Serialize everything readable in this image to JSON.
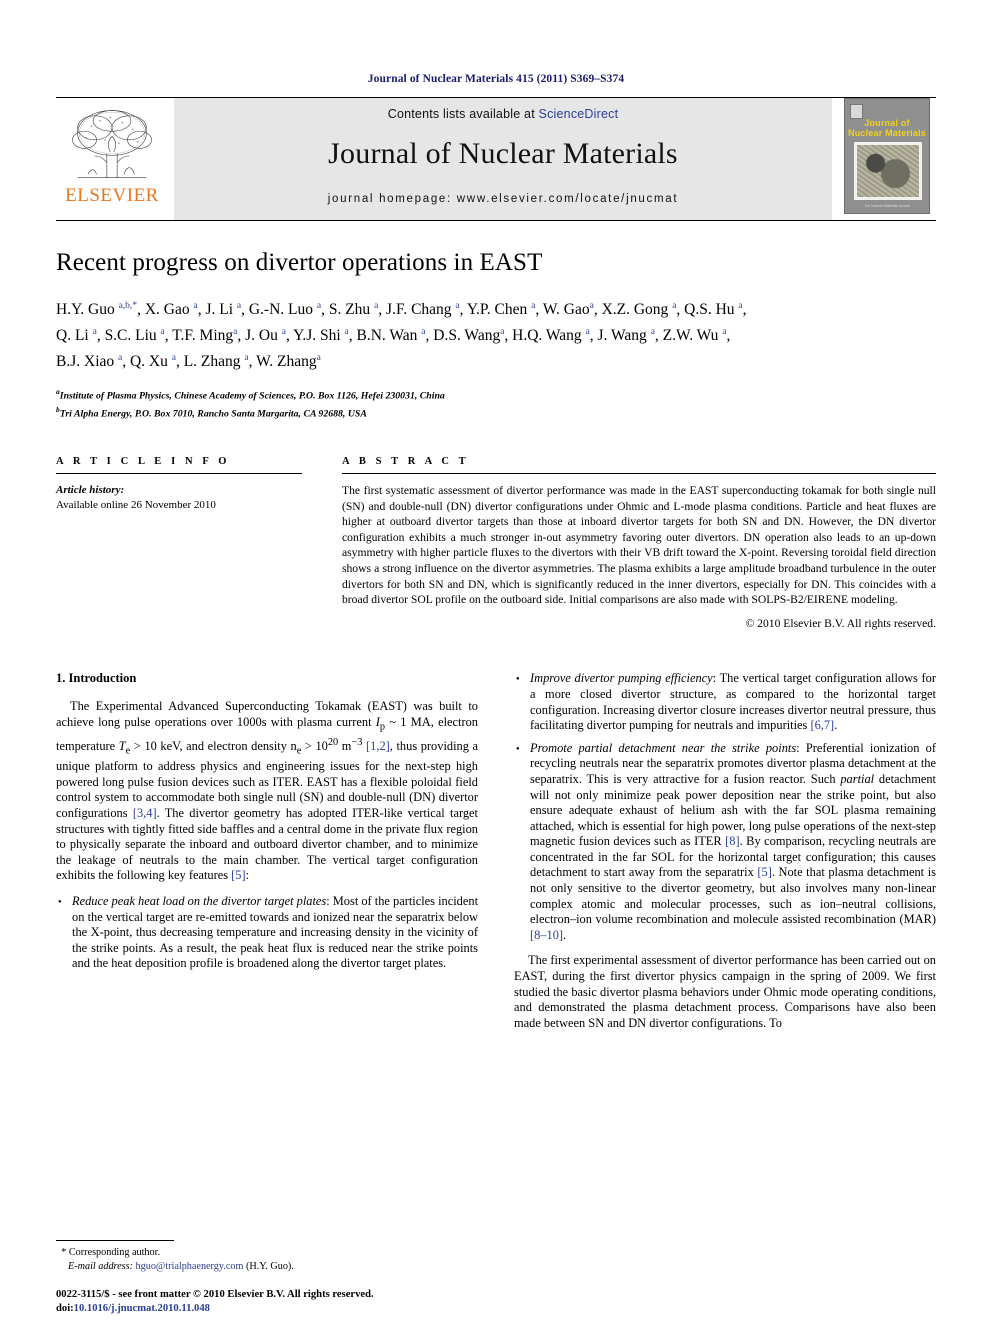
{
  "running_head": "Journal of Nuclear Materials 415 (2011) S369–S374",
  "masthead": {
    "contents_prefix": "Contents lists available at ",
    "sciencedirect": "ScienceDirect",
    "journal_title": "Journal of Nuclear Materials",
    "homepage": "journal homepage: www.elsevier.com/locate/jnucmat",
    "publisher_wordmark": "ELSEVIER",
    "cover_title_line1": "Journal of",
    "cover_title_line2": "Nuclear Materials",
    "cover_footer": "The Nuclear Materials Journal"
  },
  "article": {
    "title": "Recent progress on divertor operations in EAST",
    "authors_line1": "H.Y. Guo a,b,*, X. Gao a, J. Li a, G.-N. Luo a, S. Zhu a, J.F. Chang a, Y.P. Chen a, W. Gao a, X.Z. Gong a, Q.S. Hu a,",
    "authors_line2": "Q. Li a, S.C. Liu a, T.F. Ming a, J. Ou a, Y.J. Shi a, B.N. Wan a, D.S. Wang a, H.Q. Wang a, J. Wang a, Z.W. Wu a,",
    "authors_line3": "B.J. Xiao a, Q. Xu a, L. Zhang a, W. Zhang a",
    "affiliation_a": "Institute of Plasma Physics, Chinese Academy of Sciences, P.O. Box 1126, Hefei 230031, China",
    "affiliation_b": "Tri Alpha Energy, P.O. Box 7010, Rancho Santa Margarita, CA 92688, USA"
  },
  "article_info": {
    "heading": "A R T I C L E    I N F O",
    "history_label": "Article history:",
    "history_value": "Available online 26 November 2010"
  },
  "abstract": {
    "heading": "A B S T R A C T",
    "text": "The first systematic assessment of divertor performance was made in the EAST superconducting tokamak for both single null (SN) and double-null (DN) divertor configurations under Ohmic and L-mode plasma conditions. Particle and heat fluxes are higher at outboard divertor targets than those at inboard divertor targets for both SN and DN. However, the DN divertor configuration exhibits a much stronger in-out asymmetry favoring outer divertors. DN operation also leads to an up-down asymmetry with higher particle fluxes to the divertors with their VB drift toward the X-point. Reversing toroidal field direction shows a strong influence on the divertor asymmetries. The plasma exhibits a large amplitude broadband turbulence in the outer divertors for both SN and DN, which is significantly reduced in the inner divertors, especially for DN. This coincides with a broad divertor SOL profile on the outboard side. Initial comparisons are also made with SOLPS-B2/EIRENE modeling.",
    "copyright": "© 2010 Elsevier B.V. All rights reserved."
  },
  "section": {
    "heading": "1. Introduction",
    "para1_a": "The Experimental Advanced Superconducting Tokamak (EAST) was built to achieve long pulse operations over 1000s with plasma current ",
    "para1_ip": "I",
    "para1_ip_sub": "p",
    "para1_b": " ~ 1 MA, electron temperature ",
    "para1_te": "T",
    "para1_te_sub": "e",
    "para1_c": " > 10 keV, and electron density n",
    "para1_ne_sub": "e",
    "para1_d": " > 10",
    "para1_exp1": "20",
    "para1_e": " m",
    "para1_exp2": "−3",
    "para1_ref12": " [1,2]",
    "para1_f": ", thus providing a unique platform to address physics and engineering issues for the next-step high powered long pulse fusion devices such as ITER. EAST has a flexible poloidal field control system to accommodate both single null (SN) and double-null (DN) divertor configurations",
    "para1_ref34": " [3,4]",
    "para1_g": ". The divertor geometry has adopted ITER-like vertical target structures with tightly fitted side baffles and a central dome in the private flux region to physically separate the inboard and outboard divertor chamber, and to minimize the leakage of neutrals to the main chamber. The vertical target configuration exhibits the following key features",
    "para1_ref5": " [5]",
    "para1_h": ":",
    "bullet1_lead": "Reduce peak heat load on the divertor target plates",
    "bullet1_body": ": Most of the particles incident on the vertical target are re-emitted towards and ionized near the separatrix below the X-point, thus decreasing temperature and increasing density in the vicinity of the strike points. As a result, the peak heat flux is reduced near the strike points and the heat deposition profile is broadened along the divertor target plates.",
    "bullet2_lead": "Improve divertor pumping efficiency",
    "bullet2_body": ": The vertical target configuration allows for a more closed divertor structure, as compared to the horizontal target configuration. Increasing divertor closure increases divertor neutral pressure, thus facilitating divertor pumping for neutrals and impurities",
    "bullet2_ref": " [6,7]",
    "bullet2_end": ".",
    "bullet3_lead": "Promote partial detachment near the strike points",
    "bullet3_a": ": Preferential ionization of recycling neutrals near the separatrix promotes divertor plasma detachment at the separatrix. This is very attractive for a fusion reactor. Such ",
    "bullet3_ital": "partial",
    "bullet3_b": " detachment will not only minimize peak power deposition near the strike point, but also ensure adequate exhaust of helium ash with the far SOL plasma remaining attached, which is essential for high power, long pulse operations of the next-step magnetic fusion devices such as ITER",
    "bullet3_ref8": " [8]",
    "bullet3_c": ". By comparison, recycling neutrals are concentrated in the far SOL for the horizontal target configuration; this causes detachment to start away from the separatrix",
    "bullet3_ref5": " [5]",
    "bullet3_d": ". Note that plasma detachment is not only sensitive to the divertor geometry, but also involves many non-linear complex atomic and molecular processes, such as ion–neutral collisions, electron–ion volume recombination and molecule assisted recombination (MAR)",
    "bullet3_ref810": " [8–10]",
    "bullet3_e": ".",
    "para2": "The first experimental assessment of divertor performance has been carried out on EAST, during the first divertor physics campaign in the spring of 2009. We first studied the basic divertor plasma behaviors under Ohmic mode operating conditions, and demonstrated the plasma detachment process. Comparisons have also been made between SN and DN divertor configurations. To"
  },
  "footnotes": {
    "corresponding_star": "*",
    "corresponding_text": "Corresponding author.",
    "email_label": "E-mail address:",
    "email": "hguo@trialphaenergy.com",
    "email_owner": "(H.Y. Guo).",
    "issn_line": "0022-3115/$ - see front matter © 2010 Elsevier B.V. All rights reserved.",
    "doi_label": "doi:",
    "doi": "10.1016/j.jnucmat.2010.11.048"
  },
  "colors": {
    "link_blue": "#2b3f95",
    "elsevier_orange": "#E87722",
    "band_gray": "#e6e6e6",
    "cover_yellow": "#f2d21a"
  }
}
